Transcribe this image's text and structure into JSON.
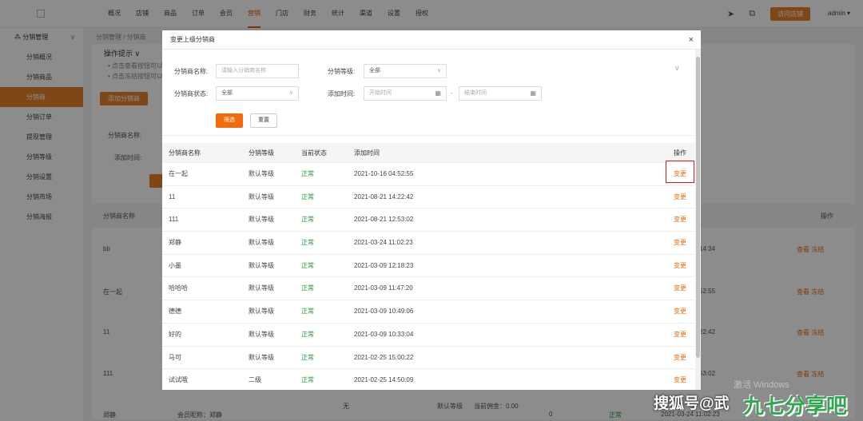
{
  "topnav": {
    "items": [
      "概况",
      "店铺",
      "商品",
      "订单",
      "会员",
      "营销",
      "门店",
      "财务",
      "统计",
      "渠道",
      "设置",
      "授权"
    ],
    "active_index": 5,
    "visit_button": "访问店铺",
    "user": "admin ▾",
    "icons": [
      "send-icon",
      "grid-icon"
    ]
  },
  "sidebar": {
    "group_label": "分销管理",
    "items": [
      "分销概况",
      "分销商品",
      "分销商",
      "分销订单",
      "提现管理",
      "分销等级",
      "分销设置",
      "分销市场",
      "分销海报"
    ],
    "active_index": 2
  },
  "background": {
    "breadcrumb": "分销管理 / 分销商",
    "tips_title": "操作提示 ∨",
    "tip1": "• 点击查看按钮可以",
    "tip2": "• 点击冻结按钮可以",
    "add_button": "添加分销商",
    "filter_name_label": "分销商名称:",
    "filter_time_label": "添加时间:",
    "col_name": "分销商名称",
    "col_op": "操作",
    "rows": [
      {
        "name": "bb",
        "time": "14:34",
        "ops": "查看 冻结"
      },
      {
        "name": "在一起",
        "time": "52:55",
        "ops": "查看 冻结"
      },
      {
        "name": "11",
        "time": "22:42",
        "ops": "查看 冻结"
      },
      {
        "name": "111",
        "time": "53:02",
        "ops": "查看 冻结"
      }
    ],
    "bottom_row": {
      "name": "郑静",
      "nick": "会员昵称：郑静",
      "none": "无",
      "level": "默认等级",
      "commission": "当前佣金：0.00",
      "zero": "0",
      "status": "正常",
      "date": "2021-03-24 11:02:23"
    }
  },
  "modal": {
    "title": "变更上级分销商",
    "close": "×",
    "filters": {
      "name_label": "分销商名称:",
      "name_placeholder": "请输入分销商名称",
      "level_label": "分销等级:",
      "level_value": "全部",
      "status_label": "分销商状态:",
      "status_value": "全部",
      "time_label": "添加时间:",
      "start_placeholder": "开始时间",
      "dash": "-",
      "end_placeholder": "结束时间",
      "filter_button": "筛选",
      "reset_button": "重置"
    },
    "table": {
      "headers": [
        "分销商名称",
        "分销等级",
        "当前状态",
        "添加时间",
        "操作"
      ],
      "rows": [
        {
          "name": "在一起",
          "level": "默认等级",
          "status": "正常",
          "time": "2021-10-16 04:52:55",
          "op": "变更"
        },
        {
          "name": "11",
          "level": "默认等级",
          "status": "正常",
          "time": "2021-08-21 14:22:42",
          "op": "变更"
        },
        {
          "name": "111",
          "level": "默认等级",
          "status": "正常",
          "time": "2021-08-21 12:53:02",
          "op": "变更"
        },
        {
          "name": "郑静",
          "level": "默认等级",
          "status": "正常",
          "time": "2021-03-24 11:02:23",
          "op": "变更"
        },
        {
          "name": "小墨",
          "level": "默认等级",
          "status": "正常",
          "time": "2021-03-09 12:18:23",
          "op": "变更"
        },
        {
          "name": "哈哈哈",
          "level": "默认等级",
          "status": "正常",
          "time": "2021-03-09 11:47:20",
          "op": "变更"
        },
        {
          "name": "德德",
          "level": "默认等级",
          "status": "正常",
          "time": "2021-03-09 10:49:06",
          "op": "变更"
        },
        {
          "name": "好的",
          "level": "默认等级",
          "status": "正常",
          "time": "2021-03-09 10:33:04",
          "op": "变更"
        },
        {
          "name": "马可",
          "level": "默认等级",
          "status": "正常",
          "time": "2021-02-25 15:00:22",
          "op": "变更"
        },
        {
          "name": "试试哦",
          "level": "二级",
          "status": "正常",
          "time": "2021-02-25 14:50:09",
          "op": "变更"
        }
      ]
    }
  },
  "watermarks": {
    "activate": "激活 Windows",
    "sohu": "搜狐号@武",
    "brand": "九七分享吧"
  },
  "colors": {
    "accent": "#e8822a",
    "status_ok": "#1a9c3a",
    "highlight": "#e01818"
  }
}
